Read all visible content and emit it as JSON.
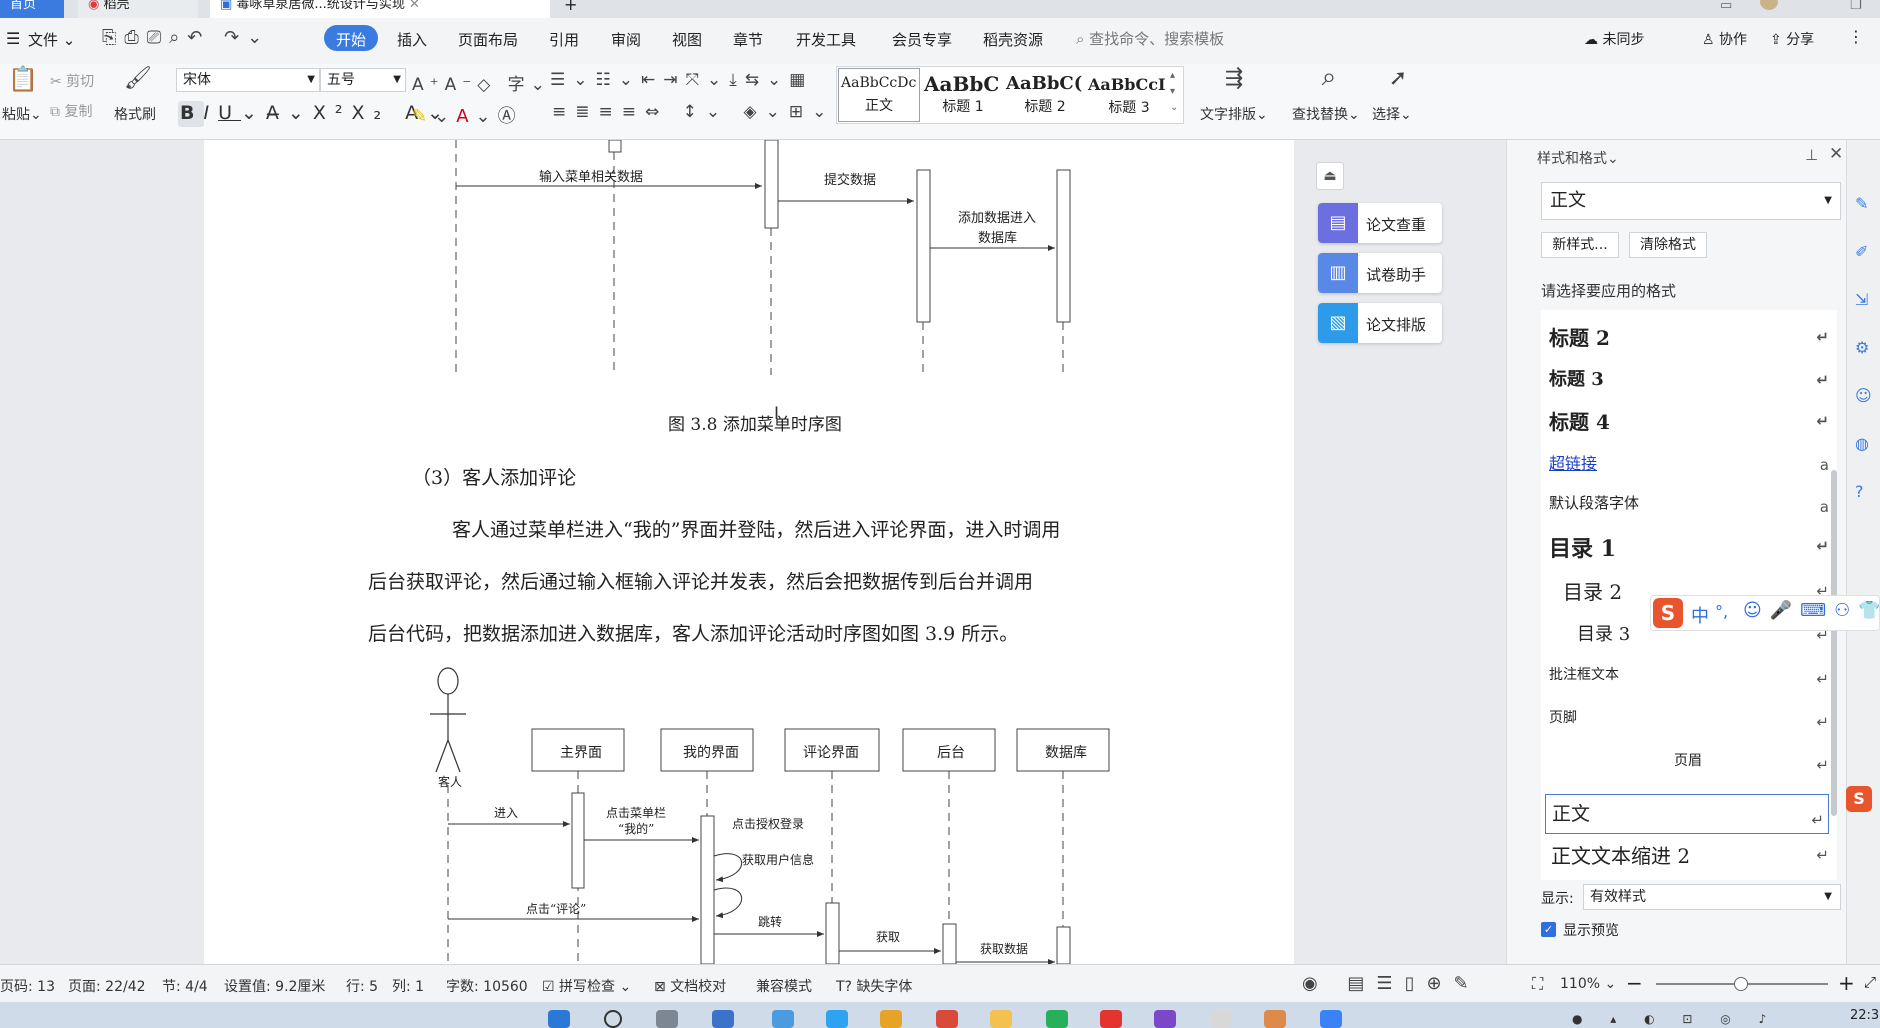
{
  "tabs": [
    {
      "label": "首页"
    },
    {
      "label": "稻壳"
    },
    {
      "label": "毒咏草泉居微...统设计与实现"
    }
  ],
  "menu": {
    "file": "文件",
    "items": [
      "开始",
      "插入",
      "页面布局",
      "引用",
      "审阅",
      "视图",
      "章节",
      "开发工具",
      "会员专享",
      "稻壳资源"
    ],
    "search_placeholder": "查找命令、搜索模板",
    "sync": "未同步",
    "collab": "协作",
    "share": "分享"
  },
  "ribbon": {
    "cut": "剪切",
    "copy": "复制",
    "paste": "粘贴",
    "format_painter": "格式刷",
    "font_name": "宋体",
    "font_size": "五号",
    "style_gallery": [
      {
        "preview": "AaBbCcDc",
        "name": "正文"
      },
      {
        "preview": "AaBbC",
        "name": "标题 1"
      },
      {
        "preview": "AaBbC(",
        "name": "标题 2"
      },
      {
        "preview": "AaBbCcI",
        "name": "标题 3"
      }
    ],
    "text_layout": "文字排版",
    "find_replace": "查找替换",
    "select": "选择"
  },
  "document": {
    "fig38": {
      "msg1": "输入菜单相关数据",
      "msg2": "提交数据",
      "msg3a": "添加数据进入",
      "msg3b": "数据库",
      "caption": "图 3.8  添加菜单时序图"
    },
    "heading": "（3）客人添加评论",
    "para": [
      "客人通过菜单栏进入“我的”界面并登陆，然后进入评论界面，进入时调用",
      "后台获取评论，然后通过输入框输入评论并发表，然后会把数据传到后台并调用",
      "后台代码，把数据添加进入数据库，客人添加评论活动时序图如图 3.9 所示。"
    ],
    "fig39": {
      "actor": "客人",
      "lifelines": [
        "主界面",
        "我的界面",
        "评论界面",
        "后台",
        "数据库"
      ],
      "msgs": {
        "enter": "进入",
        "click_menu_a": "点击菜单栏",
        "click_menu_b": "“我的”",
        "auth": "点击授权登录",
        "userinfo": "获取用户信息",
        "click_comment": "点击“评论”",
        "jump": "跳转",
        "fetch": "获取",
        "fetch_data": "获取数据"
      }
    }
  },
  "side_tools": [
    {
      "label": "论文查重"
    },
    {
      "label": "试卷助手"
    },
    {
      "label": "论文排版"
    }
  ],
  "style_panel": {
    "title": "样式和格式",
    "current": "正文",
    "new_style": "新样式...",
    "clear_format": "清除格式",
    "prompt": "请选择要应用的格式",
    "items": [
      {
        "name": "标题 2",
        "mark": "↵"
      },
      {
        "name": "标题 3",
        "mark": "↵"
      },
      {
        "name": "标题 4",
        "mark": "↵"
      },
      {
        "name": "超链接",
        "mark": "a"
      },
      {
        "name": "默认段落字体",
        "mark": "a"
      },
      {
        "name": "目录 1",
        "mark": "↵"
      },
      {
        "name": "目录 2",
        "mark": "↵"
      },
      {
        "name": "目录 3",
        "mark": "↵"
      },
      {
        "name": "批注框文本",
        "mark": "↵"
      },
      {
        "name": "页脚",
        "mark": "↵"
      },
      {
        "name": "页眉",
        "mark": "↵"
      },
      {
        "name": "正文",
        "mark": "↵"
      },
      {
        "name": "正文文本缩进 2",
        "mark": "↵"
      }
    ],
    "show_label": "显示:",
    "show_value": "有效样式",
    "preview_label": "显示预览"
  },
  "ime": {
    "zh": "中",
    "punct": "°,"
  },
  "status": {
    "pagenum": "页码: 13",
    "pages": "页面: 22/42",
    "section": "节: 4/4",
    "setting": "设置值: 9.2厘米",
    "row": "行: 5",
    "col": "列: 1",
    "words": "字数: 10560",
    "spell": "拼写检查",
    "proof": "文档校对",
    "compat": "兼容模式",
    "missing_font": "缺失字体",
    "zoom": "110%"
  },
  "clock": "22:3"
}
